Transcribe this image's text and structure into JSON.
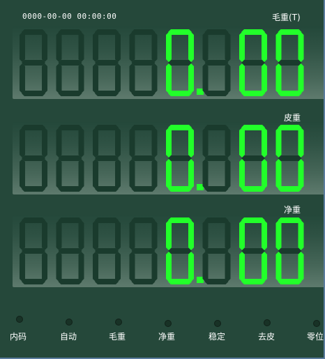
{
  "datetime": "0000-00-00 00:00:00",
  "colors": {
    "on": "#22ff2a",
    "off": "#1a3b2d",
    "background": "#25483a"
  },
  "rows": [
    {
      "label": "毛重(T)",
      "digits": [
        "",
        "",
        "",
        "",
        "0",
        "",
        "0",
        "0"
      ],
      "decimal_after": 4
    },
    {
      "label": "皮重",
      "digits": [
        "",
        "",
        "",
        "",
        "0",
        "",
        "0",
        "0"
      ],
      "decimal_after": 4
    },
    {
      "label": "净重",
      "digits": [
        "",
        "",
        "",
        "",
        "0",
        "",
        "0",
        "0"
      ],
      "decimal_after": 4
    }
  ],
  "buttons": [
    {
      "label": "内码"
    },
    {
      "label": "自动"
    },
    {
      "label": "毛重"
    },
    {
      "label": "净重"
    },
    {
      "label": "稳定"
    },
    {
      "label": "去皮"
    },
    {
      "label": "零位"
    }
  ]
}
